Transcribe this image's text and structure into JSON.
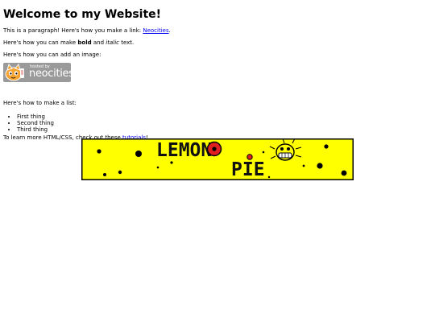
{
  "heading": "Welcome to my Website!",
  "para1": {
    "before": "This is a paragraph! Here's how you make a link: ",
    "link": "Neocities",
    "after": "."
  },
  "para2": {
    "before": "Here's how you can make ",
    "bold": "bold",
    "middle": " and ",
    "italic": "italic",
    "after": " text."
  },
  "para3": "Here's how you can add an image:",
  "badge": {
    "small": "hosted by",
    "brand": "neocities"
  },
  "para4": "Here's how to make a list:",
  "list": [
    "First thing",
    "Second thing",
    "Third thing"
  ],
  "para5": {
    "before": "To learn more HTML/CSS, check out these ",
    "link": "tutorials",
    "after": "!"
  },
  "banner": {
    "line1": "LEMON",
    "line2": "PIE"
  },
  "colors": {
    "link": "#0000ee",
    "banner_bg": "#ffff00",
    "banner_accent": "#e02020"
  }
}
